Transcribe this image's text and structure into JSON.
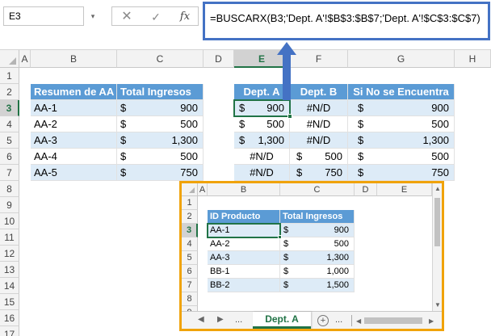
{
  "formula_bar": {
    "cell_ref": "E3",
    "cancel_glyph": "✕",
    "enter_glyph": "✓",
    "fx_label": "fx",
    "dropdown_glyph": "▾",
    "formula": "=BUSCARX(B3;'Dept. A'!$B$3:$B$7;'Dept. A'!$C$3:$C$7)"
  },
  "columns": [
    "A",
    "B",
    "C",
    "D",
    "E",
    "F",
    "G",
    "H"
  ],
  "rows": [
    "1",
    "2",
    "3",
    "4",
    "5",
    "6",
    "7",
    "8",
    "9",
    "10",
    "11",
    "12",
    "13",
    "14",
    "15",
    "16",
    "17"
  ],
  "summary_table": {
    "headers": [
      "Resumen de AA",
      "Total Ingresos"
    ],
    "rows": [
      {
        "id": "AA-1",
        "currency": "$",
        "value": "900"
      },
      {
        "id": "AA-2",
        "currency": "$",
        "value": "500"
      },
      {
        "id": "AA-3",
        "currency": "$",
        "value": "1,300"
      },
      {
        "id": "AA-4",
        "currency": "$",
        "value": "500"
      },
      {
        "id": "AA-5",
        "currency": "$",
        "value": "750"
      }
    ]
  },
  "lookup_table": {
    "headers": [
      "Dept. A",
      "Dept. B",
      "Si No se Encuentra"
    ],
    "rows": [
      {
        "e_cur": "$",
        "e_val": "900",
        "f_cur": "",
        "f_val": "#N/D",
        "g_cur": "$",
        "g_val": "900"
      },
      {
        "e_cur": "$",
        "e_val": "500",
        "f_cur": "",
        "f_val": "#N/D",
        "g_cur": "$",
        "g_val": "500"
      },
      {
        "e_cur": "$",
        "e_val": "1,300",
        "f_cur": "",
        "f_val": "#N/D",
        "g_cur": "$",
        "g_val": "1,300"
      },
      {
        "e_cur": "",
        "e_val": "#N/D",
        "f_cur": "$",
        "f_val": "500",
        "g_cur": "$",
        "g_val": "500"
      },
      {
        "e_cur": "",
        "e_val": "#N/D",
        "f_cur": "$",
        "f_val": "750",
        "g_cur": "$",
        "g_val": "750"
      }
    ]
  },
  "inset_sheet": {
    "columns": [
      "A",
      "B",
      "C",
      "D",
      "E"
    ],
    "rows": [
      "1",
      "2",
      "3",
      "4",
      "5",
      "6",
      "7",
      "8",
      "9"
    ],
    "headers": [
      "ID Producto",
      "Total Ingresos"
    ],
    "data": [
      {
        "id": "AA-1",
        "currency": "$",
        "value": "900"
      },
      {
        "id": "AA-2",
        "currency": "$",
        "value": "500"
      },
      {
        "id": "AA-3",
        "currency": "$",
        "value": "1,300"
      },
      {
        "id": "BB-1",
        "currency": "$",
        "value": "1,000"
      },
      {
        "id": "BB-2",
        "currency": "$",
        "value": "1,500"
      }
    ],
    "sheet_tab": "Dept. A",
    "nav_prev": "◀",
    "nav_next": "▶",
    "dots": "...",
    "add_glyph": "+"
  },
  "colors": {
    "header_blue": "#5b9bd5",
    "band_blue": "#ddebf7",
    "excel_green": "#217346",
    "formula_border": "#4472c4",
    "inset_border": "#f0a30a"
  }
}
